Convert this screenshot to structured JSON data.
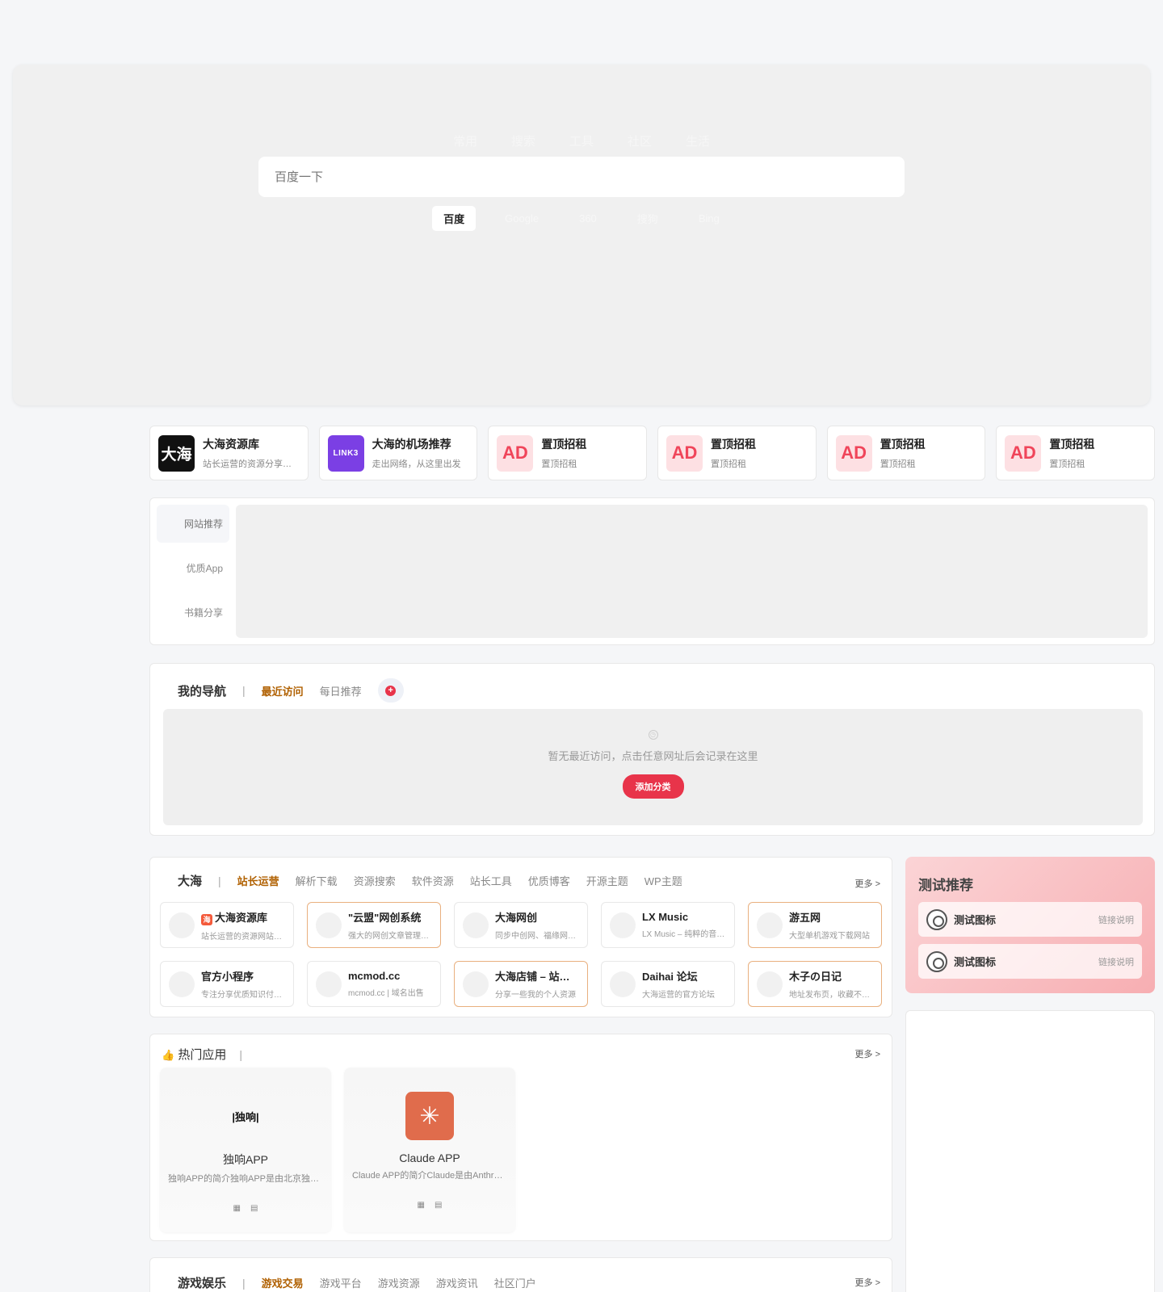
{
  "hero": {
    "tabs": [
      "常用",
      "搜索",
      "工具",
      "社区",
      "生活"
    ],
    "search_placeholder": "百度一下",
    "engines": [
      {
        "label": "百度",
        "active": true
      },
      {
        "label": "Google",
        "active": false
      },
      {
        "label": "360",
        "active": false
      },
      {
        "label": "搜狗",
        "active": false
      },
      {
        "label": "Bing",
        "active": false
      }
    ]
  },
  "ads": [
    {
      "icon": "大海",
      "title": "大海资源库",
      "desc": "站长运营的资源分享平台"
    },
    {
      "icon": "LINK3",
      "title": "大海的机场推荐",
      "desc": "走出网络，从这里出发"
    },
    {
      "icon": "AD",
      "title": "置顶招租",
      "desc": "置顶招租"
    },
    {
      "icon": "AD",
      "title": "置顶招租",
      "desc": "置顶招租"
    },
    {
      "icon": "AD",
      "title": "置顶招租",
      "desc": "置顶招租"
    },
    {
      "icon": "AD",
      "title": "置顶招租",
      "desc": "置顶招租"
    }
  ],
  "recommend_tabs": [
    "网站推荐",
    "优质App",
    "书籍分享"
  ],
  "mynav": {
    "title": "我的导航",
    "tabs": [
      "最近访问",
      "每日推荐"
    ],
    "empty_text": "暂无最近访问，点击任意网址后会记录在这里",
    "add_button": "添加分类"
  },
  "dahai": {
    "title": "大海",
    "tabs": [
      "站长运营",
      "解析下载",
      "资源搜索",
      "软件资源",
      "站长工具",
      "优质博客",
      "开源主题",
      "WP主题"
    ],
    "more": "更多 >",
    "sites": [
      {
        "title": "大海资源库",
        "desc": "站长运营的资源网站分享平台",
        "badge": "海"
      },
      {
        "title": "\"云盟\"网创系统",
        "desc": "强大的网创文章管理系统",
        "badge": ""
      },
      {
        "title": "大海网创",
        "desc": "同步中创网、福缘网资源",
        "badge": ""
      },
      {
        "title": "LX Music",
        "desc": "LX Music – 纯粹的音乐播放器",
        "badge": ""
      },
      {
        "title": "游五网",
        "desc": "大型单机游戏下载网站",
        "badge": ""
      },
      {
        "title": "官方小程序",
        "desc": "专注分享优质知识付费资源",
        "badge": ""
      },
      {
        "title": "mcmod.cc",
        "desc": "mcmod.cc | 域名出售",
        "badge": ""
      },
      {
        "title": "大海店铺 – 站长店铺",
        "desc": "分享一些我的个人资源",
        "badge": ""
      },
      {
        "title": "Daihai 论坛",
        "desc": "大海运营的官方论坛",
        "badge": ""
      },
      {
        "title": "木子の日记",
        "desc": "地址发布页，收藏不迷路",
        "badge": ""
      }
    ]
  },
  "test_recommend": {
    "title": "测试推荐",
    "items": [
      {
        "name": "测试图标",
        "note": "链接说明"
      },
      {
        "name": "测试图标",
        "note": "链接说明"
      }
    ]
  },
  "hot": {
    "title": "热门应用",
    "more": "更多 >",
    "apps": [
      {
        "logo": "|独响|",
        "name": "独响APP",
        "desc": "独响APP的简介独响APP是由北京独响科技开发",
        "platforms": [
          "▦",
          "▤"
        ]
      },
      {
        "logo": "✳",
        "name": "Claude APP",
        "desc": "Claude APP的简介Claude是由Anthropic开发",
        "platforms": [
          "▦",
          "▤"
        ]
      }
    ]
  },
  "game": {
    "title": "游戏娱乐",
    "tabs": [
      "游戏交易",
      "游戏平台",
      "游戏资源",
      "游戏资讯",
      "社区门户"
    ],
    "more": "更多 >"
  },
  "colors": {
    "accent": "#e8344a",
    "tab_active": "#b06000",
    "highlight_border": "#e9b07f"
  }
}
